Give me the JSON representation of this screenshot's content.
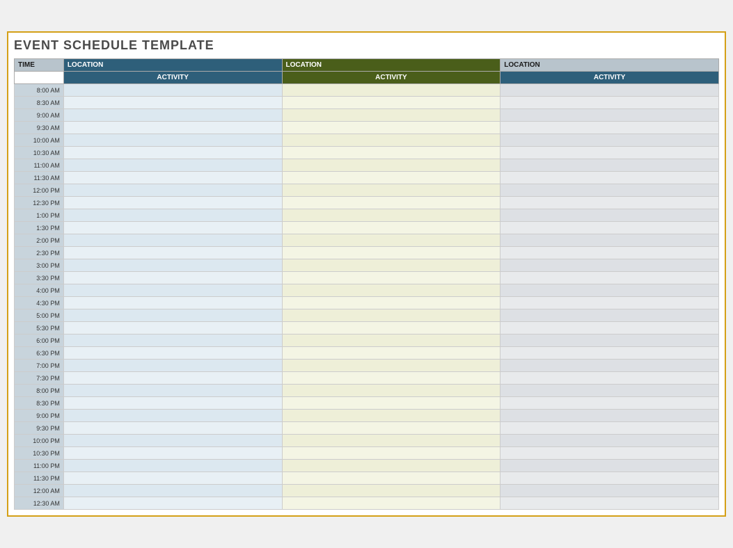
{
  "title": "EVENT SCHEDULE TEMPLATE",
  "columns": {
    "time_label": "TIME",
    "loc1_label": "LOCATION",
    "loc2_label": "LOCATION",
    "loc3_label": "LOCATION",
    "act1_label": "ACTIVITY",
    "act2_label": "ACTIVITY",
    "act3_label": "ACTIVITY"
  },
  "times": [
    "8:00 AM",
    "8:30 AM",
    "9:00 AM",
    "9:30 AM",
    "10:00 AM",
    "10:30 AM",
    "11:00 AM",
    "11:30 AM",
    "12:00 PM",
    "12:30 PM",
    "1:00 PM",
    "1:30 PM",
    "2:00 PM",
    "2:30 PM",
    "3:00 PM",
    "3:30 PM",
    "4:00 PM",
    "4:30 PM",
    "5:00 PM",
    "5:30 PM",
    "6:00 PM",
    "6:30 PM",
    "7:00 PM",
    "7:30 PM",
    "8:00 PM",
    "8:30 PM",
    "9:00 PM",
    "9:30 PM",
    "10:00 PM",
    "10:30 PM",
    "11:00 PM",
    "11:30 PM",
    "12:00 AM",
    "12:30 AM"
  ]
}
